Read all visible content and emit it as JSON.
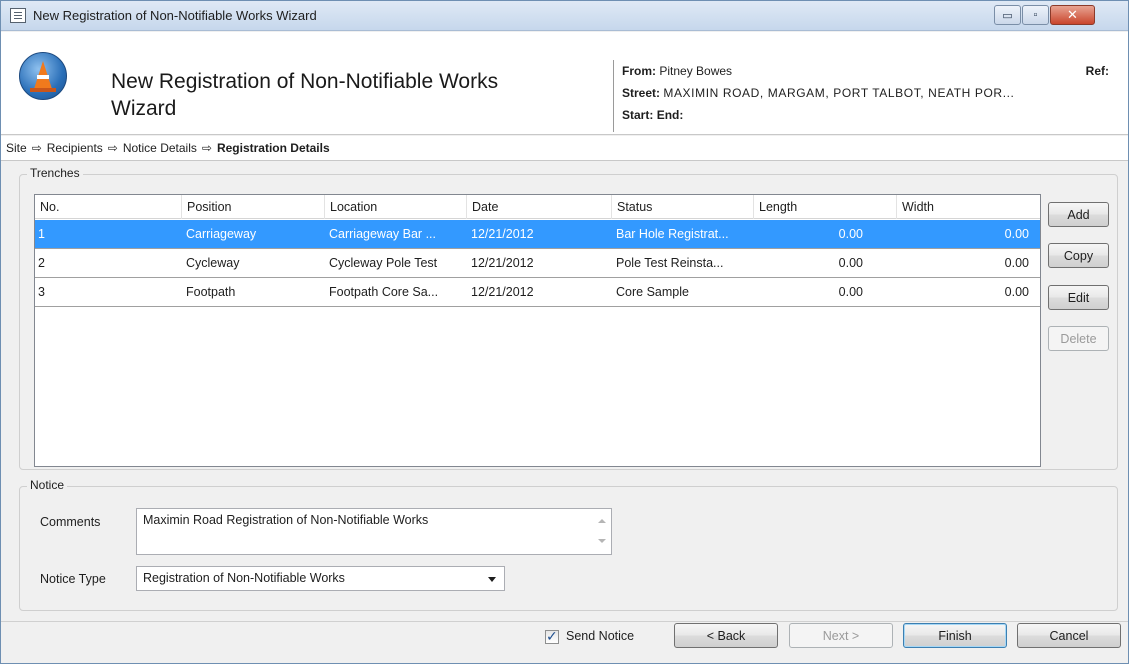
{
  "window": {
    "title": "New Registration of Non-Notifiable Works Wizard",
    "icon": "window-menu-icon",
    "controls": {
      "minimize": "▭",
      "maximize": "▫",
      "close": "✕"
    }
  },
  "header": {
    "wizard_title": "New Registration of Non-Notifiable Works Wizard",
    "from_label": "From:",
    "from_value": "Pitney Bowes",
    "ref_label": "Ref:",
    "street_label": "Street:",
    "street_value": "MAXIMIN ROAD, MARGAM, PORT TALBOT, NEATH POR...",
    "start_label": "Start:",
    "end_label": "End:",
    "logo_icon": "traffic-cone-icon"
  },
  "breadcrumb": {
    "items": [
      "Site",
      "Recipients",
      "Notice Details",
      "Registration Details"
    ],
    "separator": "⇨"
  },
  "trenches": {
    "label": "Trenches",
    "columns": [
      "No.",
      "Position",
      "Location",
      "Date",
      "Status",
      "Length",
      "Width"
    ],
    "rows": [
      [
        "1",
        "Carriageway",
        "Carriageway Bar ...",
        "12/21/2012",
        "Bar Hole Registrat...",
        "0.00",
        "0.00"
      ],
      [
        "2",
        "Cycleway",
        "Cycleway Pole Test",
        "12/21/2012",
        "Pole Test Reinsta...",
        "0.00",
        "0.00"
      ],
      [
        "3",
        "Footpath",
        "Footpath Core Sa...",
        "12/21/2012",
        "Core Sample",
        "0.00",
        "0.00"
      ]
    ],
    "selected_row": 0,
    "buttons": {
      "add": "Add",
      "copy": "Copy",
      "edit": "Edit",
      "delete": "Delete"
    }
  },
  "notice": {
    "label": "Notice",
    "comments_label": "Comments",
    "comments_value": "Maximin Road Registration of Non-Notifiable Works",
    "type_label": "Notice Type",
    "type_value": "Registration of Non-Notifiable Works"
  },
  "footer": {
    "send_notice_label": "Send Notice",
    "send_notice_checked": true,
    "back": "< Back",
    "next": "Next >",
    "finish": "Finish",
    "cancel": "Cancel"
  },
  "colors": {
    "selection": "#3399ff",
    "titlebar": "#dfe9f5",
    "close_button": "#c9452c"
  }
}
